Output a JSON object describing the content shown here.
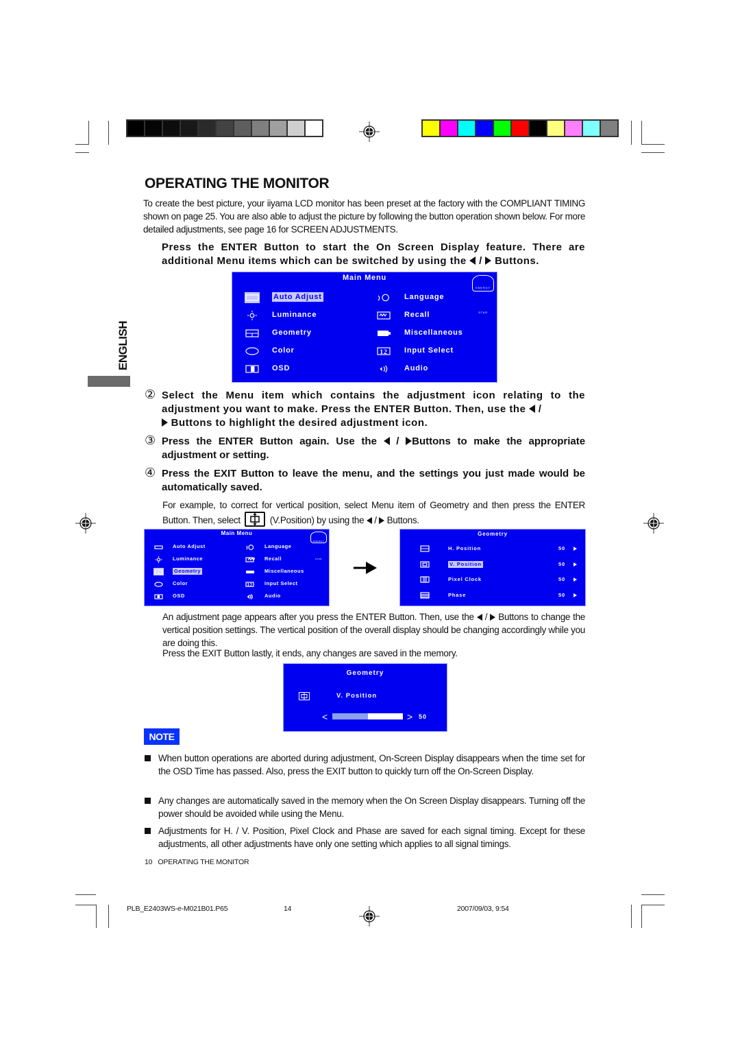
{
  "print_marks": {
    "grayscale_swatches": [
      "#000000",
      "#050505",
      "#0d0d0d",
      "#181818",
      "#2a2a2a",
      "#424242",
      "#5e5e5e",
      "#7f7f7f",
      "#a0a0a0",
      "#cfcfcf",
      "#ffffff"
    ],
    "color_swatches": [
      "#ffff00",
      "#ff00ff",
      "#00ffff",
      "#0000ff",
      "#00ff00",
      "#ff0000",
      "#000000",
      "#ffff80",
      "#ff80ff",
      "#80ffff",
      "#808080"
    ]
  },
  "page": {
    "title": "OPERATING THE MONITOR",
    "intro": "To create the best picture, your iiyama LCD monitor has been preset at the factory with the COMPLIANT TIMING shown on page 25. You are also able to adjust the picture by following the button operation shown below. For more detailed adjustments, see page 16 for SCREEN ADJUSTMENTS.",
    "language_tab": "ENGLISH",
    "step1": {
      "text_a": "Press the ENTER Button to start the On Screen Display feature. There are additional Menu items which can be switched by using the",
      "text_b": "/",
      "text_c": "Buttons."
    },
    "step2": {
      "num": "②",
      "text_a": "Select the Menu item which contains the adjustment icon relating to the adjustment you want to make. Press the ENTER Button. Then, use the",
      "text_b": "/",
      "text_c": "Buttons to highlight the desired adjustment icon."
    },
    "step3": {
      "num": "③",
      "text_a": "Press the ENTER Button again. Use the",
      "text_b": "/",
      "text_c": "Buttons to make the appropriate adjustment or setting."
    },
    "step4": {
      "num": "④",
      "text": "Press the EXIT Button to leave the menu, and the settings you just made would be automatically saved."
    },
    "example": {
      "text_a": "For example, to correct for vertical position, select Menu item of Geometry and then press the ENTER Button. Then, select",
      "text_b": "(V.Position) by using the",
      "text_c": "/",
      "text_d": "Buttons."
    },
    "after_example": {
      "text_a": "An adjustment page appears after you press the ENTER Button. Then, use the",
      "text_b": "/",
      "text_c": "Buttons to change the vertical position settings. The vertical position of the overall display should be changing accordingly while you are doing this.",
      "text_d": "Press the EXIT Button lastly, it ends, any changes are saved in the memory."
    },
    "note_label": "NOTE",
    "notes": [
      "When button operations are aborted during adjustment, On-Screen Display disappears when the time set for the OSD Time has passed. Also, press the EXIT button to quickly turn off the On-Screen Display.",
      "Any changes are automatically saved in the memory when the On Screen Display disappears. Turning off the power should be avoided while using the Menu.",
      "Adjustments for H. / V. Position, Pixel Clock and Phase are saved for each signal timing. Except for these adjustments, all other adjustments have only one setting which applies to all signal timings."
    ],
    "footer": "10   OPERATING THE MONITOR"
  },
  "osd_main_menu": {
    "title": "Main Menu",
    "energy_star": "ENERGY STAR",
    "left_items": [
      {
        "label": "Auto Adjust",
        "icon": "auto-adjust-icon"
      },
      {
        "label": "Luminance",
        "icon": "sun-icon"
      },
      {
        "label": "Geometry",
        "icon": "geometry-icon"
      },
      {
        "label": "Color",
        "icon": "palette-icon"
      },
      {
        "label": "OSD",
        "icon": "osd-icon"
      }
    ],
    "right_items": [
      {
        "label": "Language",
        "icon": "language-icon"
      },
      {
        "label": "Recall",
        "icon": "recall-icon"
      },
      {
        "label": "Miscellaneous",
        "icon": "miscellaneous-icon"
      },
      {
        "label": "Input Select",
        "icon": "input-select-icon",
        "glyph": "12"
      },
      {
        "label": "Audio",
        "icon": "speaker-icon"
      }
    ],
    "highlighted_large": "Auto Adjust",
    "highlighted_small": "Geometry"
  },
  "osd_geometry": {
    "title": "Geometry",
    "items": [
      {
        "label": "H. Position",
        "value": "50"
      },
      {
        "label": "V. Position",
        "value": "50"
      },
      {
        "label": "Pixel Clock",
        "value": "50"
      },
      {
        "label": "Phase",
        "value": "50"
      }
    ],
    "highlighted": "V. Position"
  },
  "osd_adjust": {
    "title": "Geometry",
    "item": "V. Position",
    "value": "50",
    "slider_fraction": 0.5
  },
  "slug": {
    "file": "PLB_E2403WS-e-M021B01.P65",
    "page": "14",
    "date": "2007/09/03, 9:54"
  }
}
